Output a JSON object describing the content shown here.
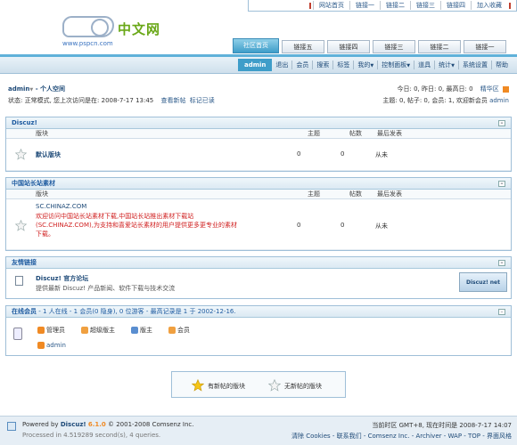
{
  "topnav": [
    "网站首页",
    "链接一",
    "链接二",
    "链接三",
    "链接四",
    "加入收藏"
  ],
  "logo": {
    "cn": "中文网",
    "url": "www.pspcn.com"
  },
  "tabs": [
    "社区首页",
    "链接五",
    "链接四",
    "链接三",
    "链接二",
    "链接一"
  ],
  "menu": {
    "user": "admin",
    "items": [
      "退出",
      "会员",
      "搜索",
      "标签",
      "我的",
      "控制面板",
      "道具",
      "统计",
      "系统设置",
      "帮助"
    ]
  },
  "userinfo": {
    "name": "admin",
    "space": "- 个人空间",
    "status": "状态: 正常模式, 您上次访问是在: 2008-7-17 13:45",
    "newposts": "查看新帖",
    "markread": "标记已读"
  },
  "stats": {
    "line1": "今日: 0, 昨日: 0, 最高日: 0",
    "digest": "精华区",
    "line2": "主题: 0, 帖子: 0, 会员: 1, 欢迎新会员",
    "newmember": "admin"
  },
  "cols": {
    "forum": "版块",
    "threads": "主题",
    "posts": "帖数",
    "last": "最后发表"
  },
  "sec1": {
    "title": "Discuz!",
    "forum": "默认版块",
    "threads": "0",
    "posts": "0",
    "last": "从未"
  },
  "sec2": {
    "title": "中国站长站素材",
    "fname": "SC.CHINAZ.COM",
    "desc1": "欢迎访问中国站长站素材下载,中国站长站推出素材下载站",
    "desc2": "(SC.CHINAZ.COM),为支持和喜爱站长素材的用户提供更多更专业的素材",
    "desc3": "下载。",
    "threads": "0",
    "posts": "0",
    "last": "从未"
  },
  "links": {
    "title": "友情链接",
    "name": "Discuz! 官方论坛",
    "desc": "提供最新 Discuz! 产品新闻、软件下载与技术交流",
    "badge": "Discuz! net"
  },
  "online": {
    "title": "在线会员",
    "summary": "- 1 人在线 - 1 会员(0 隐身), 0 位游客 - 最高记录是 1 于 2002-12-16.",
    "roles": [
      "管理员",
      "超级版主",
      "版主",
      "会员"
    ],
    "user": "admin"
  },
  "legend": {
    "new": "有新帖的版块",
    "none": "无新帖的版块"
  },
  "footer": {
    "powered": "Powered by",
    "brand": "Discuz!",
    "ver": "6.1.0",
    "copy": "© 2001-2008 Comsenz Inc.",
    "processed": "Processed in 4.519289 second(s), 4 queries.",
    "time": "当前时区 GMT+8, 现在时间是 2008-7-17 14:07",
    "links": "清除 Cookies - 联系我们 - Comsenz Inc. - Archiver - WAP - TOP - 界面风格"
  },
  "colors": {
    "accent": "#3e9dc9",
    "link": "#2c5a8a",
    "red": "#d02020"
  }
}
